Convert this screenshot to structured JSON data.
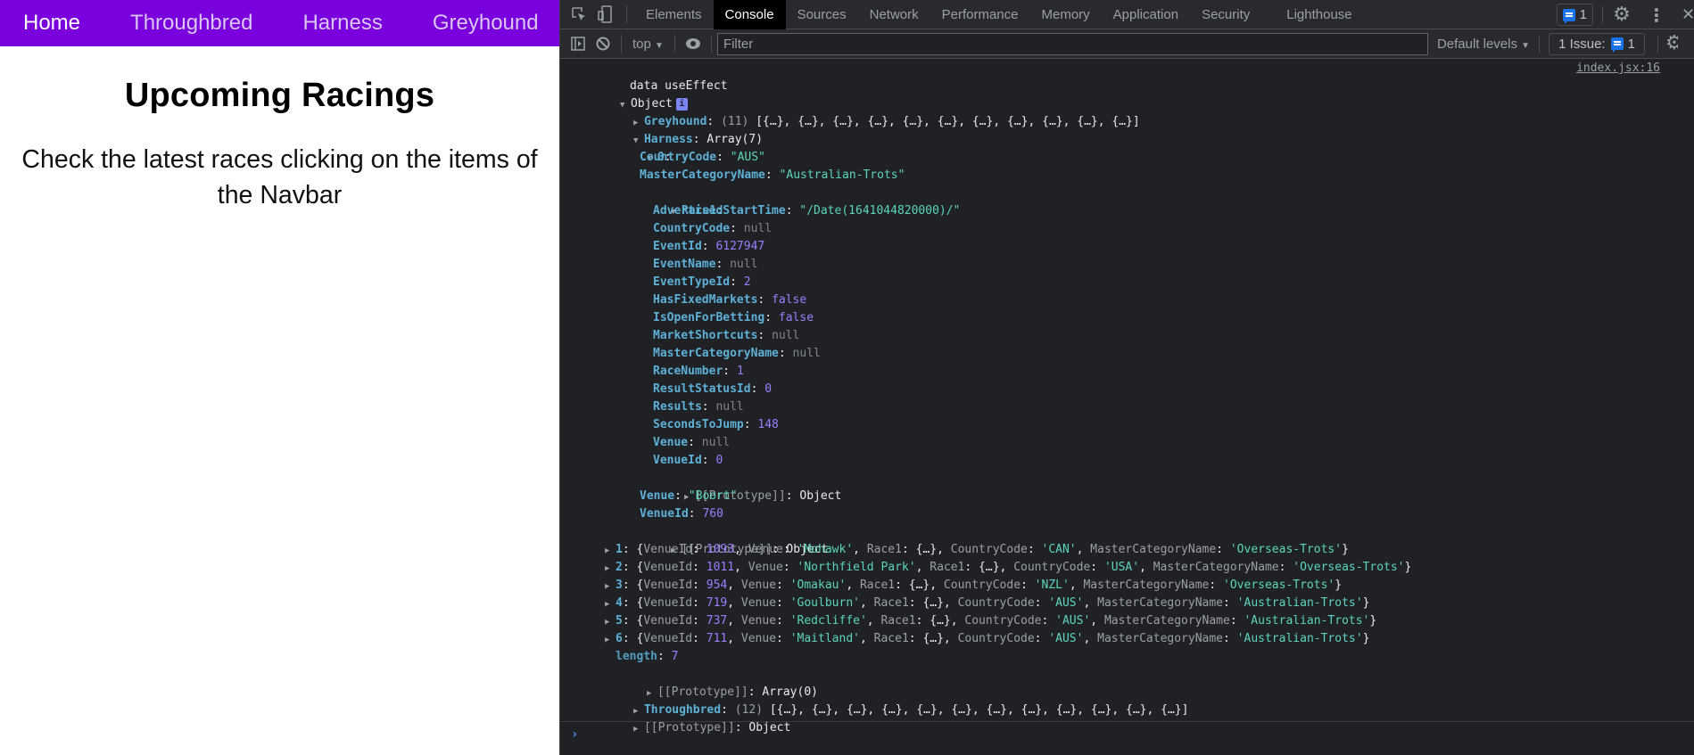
{
  "app": {
    "nav": [
      {
        "label": "Home",
        "active": true
      },
      {
        "label": "Throughbred",
        "active": false
      },
      {
        "label": "Harness",
        "active": false
      },
      {
        "label": "Greyhound",
        "active": false
      }
    ],
    "title": "Upcoming Racings",
    "subtitle": "Check the latest races clicking on the items of the Navbar"
  },
  "devtools": {
    "tabs": [
      "Elements",
      "Console",
      "Sources",
      "Network",
      "Performance",
      "Memory",
      "Application",
      "Security",
      "Lighthouse"
    ],
    "active_tab": "Console",
    "messages_badge": "1",
    "context": "top",
    "filter_placeholder": "Filter",
    "levels": "Default levels",
    "issues_label": "1 Issue:",
    "issues_count": "1",
    "icons": {
      "inspect": "inspect-element-icon",
      "device": "device-toolbar-icon",
      "sidebar": "console-sidebar-icon",
      "clear": "clear-console-icon",
      "eye": "live-expression-icon",
      "settings": "gear-icon",
      "more": "kebab-menu-icon",
      "close": "close-icon"
    }
  },
  "console": {
    "log_label": "data useEffect",
    "source": "index.jsx:16",
    "root": "Object",
    "greyhound": {
      "key": "Greyhound",
      "count": "(11)",
      "preview": "[{…}, {…}, {…}, {…}, {…}, {…}, {…}, {…}, {…}, {…}, {…}]"
    },
    "harness": {
      "key": "Harness",
      "summary": "Array(7)"
    },
    "item0": {
      "index": "0",
      "CountryCode": "\"AUS\"",
      "MasterCategoryName": "\"Australian-Trots\"",
      "race1_key": "Race1",
      "race1": [
        {
          "k": "AdvertisedStartTime",
          "v": "\"/Date(1641044820000)/\"",
          "t": "str"
        },
        {
          "k": "CountryCode",
          "v": "null",
          "t": "nul"
        },
        {
          "k": "EventId",
          "v": "6127947",
          "t": "num"
        },
        {
          "k": "EventName",
          "v": "null",
          "t": "nul"
        },
        {
          "k": "EventTypeId",
          "v": "2",
          "t": "num"
        },
        {
          "k": "HasFixedMarkets",
          "v": "false",
          "t": "num"
        },
        {
          "k": "IsOpenForBetting",
          "v": "false",
          "t": "num"
        },
        {
          "k": "MarketShortcuts",
          "v": "null",
          "t": "nul"
        },
        {
          "k": "MasterCategoryName",
          "v": "null",
          "t": "nul"
        },
        {
          "k": "RaceNumber",
          "v": "1",
          "t": "num"
        },
        {
          "k": "ResultStatusId",
          "v": "0",
          "t": "num"
        },
        {
          "k": "Results",
          "v": "null",
          "t": "nul"
        },
        {
          "k": "SecondsToJump",
          "v": "148",
          "t": "num"
        },
        {
          "k": "Venue",
          "v": "null",
          "t": "nul"
        },
        {
          "k": "VenueId",
          "v": "0",
          "t": "num"
        }
      ],
      "Venue": "\"Boort\"",
      "VenueId": "760"
    },
    "harness_items": [
      {
        "i": "1",
        "VenueId": "1093",
        "Venue": "'Mohawk'",
        "CountryCode": "'CAN'",
        "MasterCategoryName": "'Overseas-Trots'"
      },
      {
        "i": "2",
        "VenueId": "1011",
        "Venue": "'Northfield Park'",
        "CountryCode": "'USA'",
        "MasterCategoryName": "'Overseas-Trots'"
      },
      {
        "i": "3",
        "VenueId": "954",
        "Venue": "'Omakau'",
        "CountryCode": "'NZL'",
        "MasterCategoryName": "'Overseas-Trots'"
      },
      {
        "i": "4",
        "VenueId": "719",
        "Venue": "'Goulburn'",
        "CountryCode": "'AUS'",
        "MasterCategoryName": "'Australian-Trots'"
      },
      {
        "i": "5",
        "VenueId": "737",
        "Venue": "'Redcliffe'",
        "CountryCode": "'AUS'",
        "MasterCategoryName": "'Australian-Trots'"
      },
      {
        "i": "6",
        "VenueId": "711",
        "Venue": "'Maitland'",
        "CountryCode": "'AUS'",
        "MasterCategoryName": "'Australian-Trots'"
      }
    ],
    "race1_preview": "{…}",
    "length": "7",
    "proto_label": "[[Prototype]]",
    "proto_object": "Object",
    "proto_array": "Array(0)",
    "throughbred": {
      "key": "Throughbred",
      "count": "(12)",
      "preview": "[{…}, {…}, {…}, {…}, {…}, {…}, {…}, {…}, {…}, {…}, {…}, {…}]"
    }
  }
}
